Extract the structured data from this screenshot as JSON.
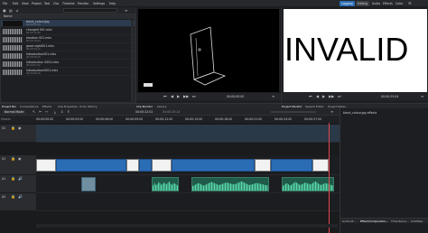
{
  "menubar": {
    "items": [
      "File",
      "Edit",
      "View",
      "Project",
      "Tool",
      "Clip",
      "Timeline",
      "Monitor",
      "Settings",
      "Help"
    ],
    "workspaces": [
      "Logging",
      "Editing",
      "Audio",
      "Effects",
      "Color"
    ],
    "active_workspace": "Editing"
  },
  "bin": {
    "header": "Name",
    "items": [
      {
        "name": "black_colour.jpg",
        "dur": "00:00:05:00",
        "kind": "image"
      },
      {
        "name": "changed 001.mkv",
        "dur": "00:00:12:08",
        "kind": "audio"
      },
      {
        "name": "emotion 001.mkv",
        "dur": "00:00:10:04",
        "kind": "audio"
      },
      {
        "name": "good night001.mkv",
        "dur": "00:00:09:12",
        "kind": "audio"
      },
      {
        "name": "introduction001.mkv",
        "dur": "00:00:06:20",
        "kind": "audio"
      },
      {
        "name": "introduction 0001.mkv",
        "dur": "00:00:07:02",
        "kind": "audio"
      },
      {
        "name": "introduction0001.mkv",
        "dur": "00:00:08:16",
        "kind": "audio"
      }
    ]
  },
  "clip_monitor": {
    "timecode": "00:00:00:00"
  },
  "project_monitor": {
    "text": "INVALID",
    "timecode": "00:00:25:04"
  },
  "tabs_left": [
    "Project Bin",
    "Compositions",
    "Effects",
    "Clip Properties",
    "Undo History"
  ],
  "tabs_mid": [
    "Clip Monitor",
    "Library"
  ],
  "tabs_right": [
    "Project Monitor",
    "Speech Editor",
    "Project Notes"
  ],
  "timeline": {
    "mode": "Normal Mode",
    "position": "00:00:22:02",
    "duration": "00:00:25:14",
    "ruler": [
      "00:00:00:00",
      "00:00:03:00",
      "00:00:06:00",
      "00:00:09:00",
      "00:00:12:00",
      "00:00:15:00",
      "00:00:18:00",
      "00:00:21:00",
      "00:00:24:00",
      "00:00:27:00"
    ],
    "tracks": [
      "V2",
      "V1",
      "A1",
      "A2"
    ]
  },
  "effects_panel": {
    "title": "black_colour.jpg effects",
    "bottom_tabs": [
      "Audio M...",
      "Effect/Composition...",
      "Time Rema...",
      "Subtitles"
    ]
  },
  "colors": {
    "accent": "#2b6db5",
    "audio": "#58d7a8",
    "playhead": "#e5484d"
  }
}
